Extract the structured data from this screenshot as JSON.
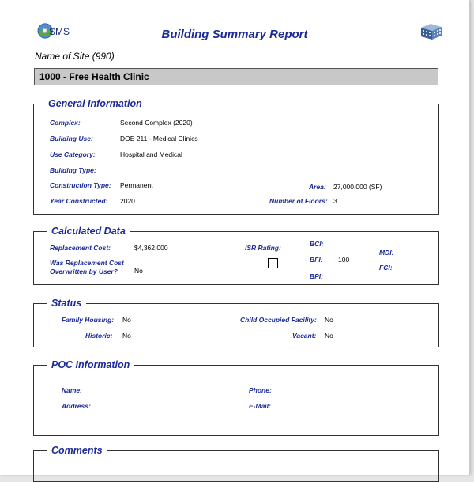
{
  "header": {
    "logo_text": "SMS",
    "title": "Building Summary Report",
    "site": "Name of Site (990)",
    "building": "1000 - Free Health Clinic"
  },
  "general": {
    "heading": "General Information",
    "complex_label": "Complex:",
    "complex": "Second Complex (2020)",
    "use_label": "Building Use:",
    "use": "DOE 211 - Medical Clinics",
    "category_label": "Use Category:",
    "category": "Hospital and Medical",
    "type_label": "Building Type:",
    "type": "",
    "construction_label": "Construction Type:",
    "construction": "Permanent",
    "area_label": "Area:",
    "area": "27,000,000 (SF)",
    "year_label": "Year Constructed:",
    "year": "2020",
    "floors_label": "Number of Floors:",
    "floors": "3"
  },
  "calculated": {
    "heading": "Calculated Data",
    "replacement_label": "Replacement Cost:",
    "replacement": "$4,362,000",
    "overwritten_label1": "Was Replacement Cost",
    "overwritten_label2": "Overwritten by User?",
    "overwritten": "No",
    "isr_label": "ISR Rating:",
    "bci_label": "BCI:",
    "bci": "",
    "bfi_label": "BFI:",
    "bfi": "100",
    "bpi_label": "BPI:",
    "bpi": "",
    "mdi_label": "MDI:",
    "mdi": "",
    "fci_label": "FCI:",
    "fci": ""
  },
  "status": {
    "heading": "Status",
    "family_label": "Family Housing:",
    "family": "No",
    "historic_label": "Historic:",
    "historic": "No",
    "child_label": "Child Occupied Facility:",
    "child": "No",
    "vacant_label": "Vacant:",
    "vacant": "No"
  },
  "poc": {
    "heading": "POC Information",
    "name_label": "Name:",
    "name": "",
    "address_label": "Address:",
    "address": "",
    "phone_label": "Phone:",
    "phone": "",
    "email_label": "E-Mail:",
    "email": "",
    "dot": "."
  },
  "comments": {
    "heading": "Comments"
  }
}
